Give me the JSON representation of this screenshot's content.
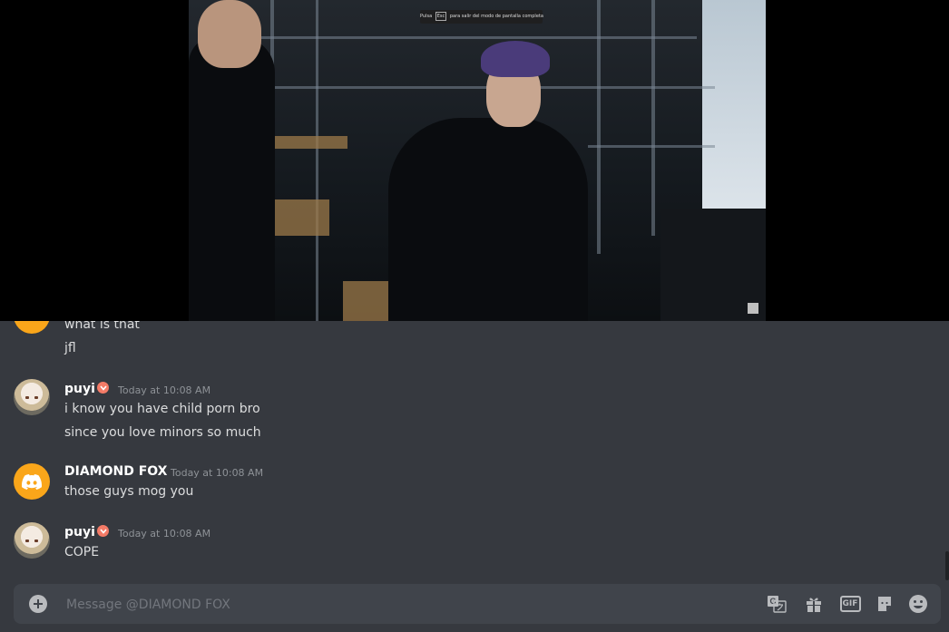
{
  "video": {
    "fullscreen_hint_pre": "Pulsa",
    "fullscreen_hint_key": "Esc",
    "fullscreen_hint_post": "para salir del modo de pantalla completa"
  },
  "messages": [
    {
      "lines": [
        "what is that",
        "jfl"
      ]
    },
    {
      "author": "puyi",
      "time": "Today at 10:08 AM",
      "lines": [
        "i know you have child porn bro",
        "since you love minors so much"
      ]
    },
    {
      "author": "DIAMOND FOX",
      "time": "Today at 10:08 AM",
      "lines": [
        "those guys mog you"
      ]
    },
    {
      "author": "puyi",
      "time": "Today at 10:08 AM",
      "lines": [
        "COPE"
      ]
    }
  ],
  "composer": {
    "placeholder": "Message @DIAMOND FOX"
  },
  "icons": [
    "plus-circle-icon",
    "translate-icon",
    "gift-icon",
    "gif-icon",
    "sticker-icon",
    "emoji-icon",
    "discord-logo-icon"
  ],
  "colors": {
    "chat_bg": "#36393f",
    "composer_bg": "#40444b",
    "discord_avatar": "#faa61a",
    "badge": "#f47b67",
    "text": "#dcddde",
    "muted": "#8e9297"
  },
  "toolbar": {
    "gif_label": "GIF"
  }
}
